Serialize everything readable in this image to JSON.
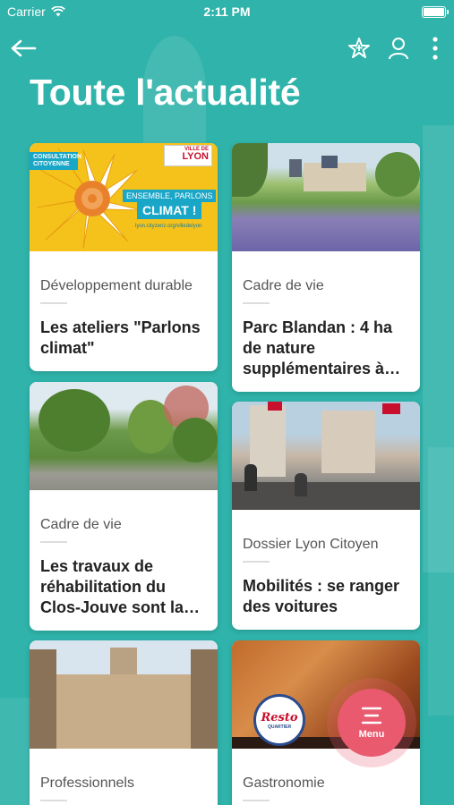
{
  "status_bar": {
    "carrier": "Carrier",
    "time": "2:11 PM"
  },
  "nav": {
    "back_icon": "arrow-left-icon",
    "favorites_icon": "star-add-icon",
    "profile_icon": "user-icon",
    "more_icon": "vertical-dots-icon"
  },
  "page": {
    "title": "Toute l'actualité"
  },
  "cards": [
    {
      "category": "Développement durable",
      "title": "Les ateliers \"Parlons climat\"",
      "image": {
        "badge_left": "CONSULTATION CITOYENNE",
        "badge_right_top": "VILLE DE",
        "badge_right": "LYON",
        "tagline": "ENSEMBLE, PARLONS",
        "headline": "CLIMAT !",
        "url": "lyon.cityzenz.org/villedelyon"
      }
    },
    {
      "category": "Cadre de vie",
      "title": "Parc Blandan : 4 ha de nature supplémentaires à…"
    },
    {
      "category": "Cadre de vie",
      "title": "Les travaux de réhabilitation du Clos-Jouve sont la…"
    },
    {
      "category": "Dossier Lyon Citoyen",
      "title": "Mobilités : se ranger des voitures"
    },
    {
      "category": "Professionnels",
      "title": ""
    },
    {
      "category": "Gastronomie",
      "title": "",
      "image": {
        "logo_text": "Resto",
        "logo_sub": "QUARTIER"
      }
    }
  ],
  "fab": {
    "label": "Menu",
    "icon": "menu-lines-icon"
  },
  "colors": {
    "background": "#2fb3aa",
    "fab": "#e95a6f",
    "card": "#ffffff"
  }
}
